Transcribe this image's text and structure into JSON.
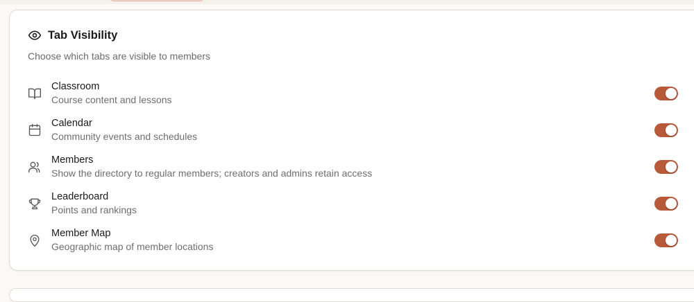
{
  "tab_visibility": {
    "title": "Tab Visibility",
    "subtitle": "Choose which tabs are visible to members",
    "items": [
      {
        "label": "Classroom",
        "description": "Course content and lessons",
        "icon": "book-icon",
        "enabled": true
      },
      {
        "label": "Calendar",
        "description": "Community events and schedules",
        "icon": "calendar-icon",
        "enabled": true
      },
      {
        "label": "Members",
        "description": "Show the directory to regular members; creators and admins retain access",
        "icon": "users-icon",
        "enabled": true
      },
      {
        "label": "Leaderboard",
        "description": "Points and rankings",
        "icon": "trophy-icon",
        "enabled": true
      },
      {
        "label": "Member Map",
        "description": "Geographic map of member locations",
        "icon": "map-pin-icon",
        "enabled": true
      }
    ]
  },
  "colors": {
    "toggle_on": "#b85a3a",
    "accent_strip": "#f1d5c8"
  }
}
